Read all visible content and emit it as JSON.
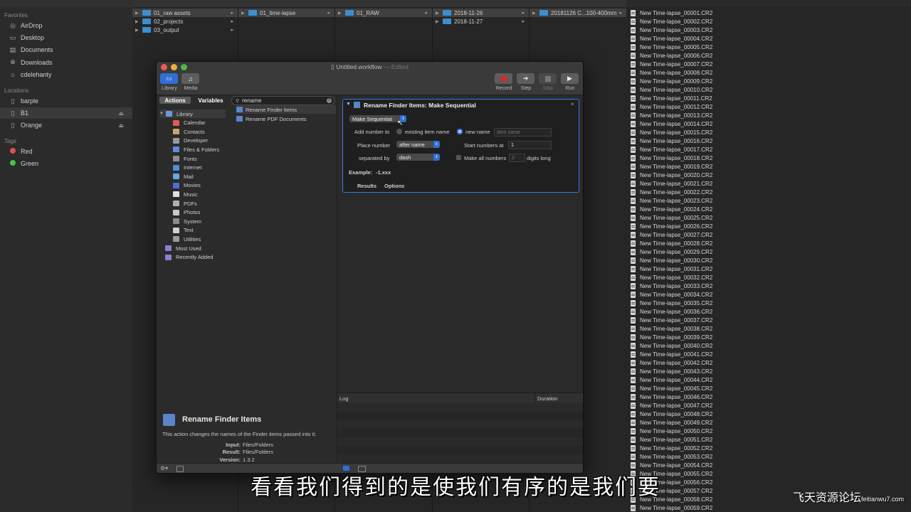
{
  "sidebar": {
    "favorites_label": "Favorites",
    "favorites": [
      {
        "label": "AirDrop",
        "icon": "airdrop-icon"
      },
      {
        "label": "Desktop",
        "icon": "desktop-icon"
      },
      {
        "label": "Documents",
        "icon": "documents-icon"
      },
      {
        "label": "Downloads",
        "icon": "downloads-icon"
      },
      {
        "label": "cdelehanty",
        "icon": "home-icon"
      }
    ],
    "locations_label": "Locations",
    "locations": [
      {
        "label": "barple",
        "icon": "disk-icon"
      },
      {
        "label": "B1",
        "icon": "disk-icon",
        "selected": true
      },
      {
        "label": "Orange",
        "icon": "disk-icon"
      }
    ],
    "tags_label": "Tags",
    "tags": [
      {
        "label": "Red",
        "color": "#e0504a"
      },
      {
        "label": "Green",
        "color": "#3ec64a"
      }
    ]
  },
  "columns": {
    "col1": [
      "01_raw assets",
      "02_projects",
      "03_output"
    ],
    "col2": [
      "01_time-lapse"
    ],
    "col3": [
      "01_RAW"
    ],
    "col4": [
      "2018-11-26",
      "2018-11-27"
    ],
    "col5": [
      "20181126 C...100-400mm"
    ]
  },
  "files": [
    "New Time-lapse_00001.CR2",
    "New Time-lapse_00002.CR2",
    "New Time-lapse_00003.CR2",
    "New Time-lapse_00004.CR2",
    "New Time-lapse_00005.CR2",
    "New Time-lapse_00006.CR2",
    "New Time-lapse_00007.CR2",
    "New Time-lapse_00008.CR2",
    "New Time-lapse_00009.CR2",
    "New Time-lapse_00010.CR2",
    "New Time-lapse_00011.CR2",
    "New Time-lapse_00012.CR2",
    "New Time-lapse_00013.CR2",
    "New Time-lapse_00014.CR2",
    "New Time-lapse_00015.CR2",
    "New Time-lapse_00016.CR2",
    "New Time-lapse_00017.CR2",
    "New Time-lapse_00018.CR2",
    "New Time-lapse_00019.CR2",
    "New Time-lapse_00020.CR2",
    "New Time-lapse_00021.CR2",
    "New Time-lapse_00022.CR2",
    "New Time-lapse_00023.CR2",
    "New Time-lapse_00024.CR2",
    "New Time-lapse_00025.CR2",
    "New Time-lapse_00026.CR2",
    "New Time-lapse_00027.CR2",
    "New Time-lapse_00028.CR2",
    "New Time-lapse_00029.CR2",
    "New Time-lapse_00030.CR2",
    "New Time-lapse_00031.CR2",
    "New Time-lapse_00032.CR2",
    "New Time-lapse_00033.CR2",
    "New Time-lapse_00034.CR2",
    "New Time-lapse_00035.CR2",
    "New Time-lapse_00036.CR2",
    "New Time-lapse_00037.CR2",
    "New Time-lapse_00038.CR2",
    "New Time-lapse_00039.CR2",
    "New Time-lapse_00040.CR2",
    "New Time-lapse_00041.CR2",
    "New Time-lapse_00042.CR2",
    "New Time-lapse_00043.CR2",
    "New Time-lapse_00044.CR2",
    "New Time-lapse_00045.CR2",
    "New Time-lapse_00046.CR2",
    "New Time-lapse_00047.CR2",
    "New Time-lapse_00048.CR2",
    "New Time-lapse_00049.CR2",
    "New Time-lapse_00050.CR2",
    "New Time-lapse_00051.CR2",
    "New Time-lapse_00052.CR2",
    "New Time-lapse_00053.CR2",
    "New Time-lapse_00054.CR2",
    "New Time-lapse_00055.CR2",
    "New Time-lapse_00056.CR2",
    "New Time-lapse_00057.CR2",
    "New Time-lapse_00058.CR2",
    "New Time-lapse_00059.CR2"
  ],
  "automator": {
    "title": "Untitled.workflow",
    "title_suffix": "— Edited",
    "toolbar": {
      "library": "Library",
      "media": "Media",
      "record": "Record",
      "step": "Step",
      "stop": "Stop",
      "run": "Run"
    },
    "tabs": {
      "actions": "Actions",
      "variables": "Variables"
    },
    "search_value": "rename",
    "library_items": [
      {
        "label": "Library",
        "color": "#6a9bd8"
      },
      {
        "label": "Calendar",
        "color": "#e35b4b"
      },
      {
        "label": "Contacts",
        "color": "#c9a46a"
      },
      {
        "label": "Developer",
        "color": "#9a9a9a"
      },
      {
        "label": "Files & Folders",
        "color": "#5d8ed6"
      },
      {
        "label": "Fonts",
        "color": "#8f8f8f"
      },
      {
        "label": "Internet",
        "color": "#4a8ed8"
      },
      {
        "label": "Mail",
        "color": "#6ba6e6"
      },
      {
        "label": "Movies",
        "color": "#4d6ed0"
      },
      {
        "label": "Music",
        "color": "#e0e0e0"
      },
      {
        "label": "PDFs",
        "color": "#b0b0b0"
      },
      {
        "label": "Photos",
        "color": "#c8c8c8"
      },
      {
        "label": "System",
        "color": "#8a8a8a"
      },
      {
        "label": "Text",
        "color": "#d0d0d0"
      },
      {
        "label": "Utilities",
        "color": "#9a9a9a"
      },
      {
        "label": "Most Used",
        "color": "#8a7fd0"
      },
      {
        "label": "Recently Added",
        "color": "#8a7fd0"
      }
    ],
    "actions": [
      "Rename Finder Items",
      "Rename PDF Documents"
    ],
    "description": {
      "title": "Rename Finder Items",
      "text": "This action changes the names of the Finder items passed into it.",
      "input_label": "Input:",
      "input_value": "Files/Folders",
      "result_label": "Result:",
      "result_value": "Files/Folders",
      "version_label": "Version:",
      "version_value": "1.3.2"
    },
    "action_card": {
      "title": "Rename Finder Items: Make Sequential",
      "mode": "Make Sequential",
      "add_number_label": "Add number to",
      "existing_label": "existing item name",
      "new_name_label": "new name",
      "name_placeholder": "Item name",
      "place_label": "Place number",
      "place_value": "after name",
      "start_label": "Start numbers at",
      "start_value": "1",
      "separated_label": "separated by",
      "separated_value": "dash",
      "make_all_label": "Make all numbers",
      "digits_value": "2",
      "digits_label": "digits long",
      "example_label": "Example:",
      "example_value": "-1.xxx",
      "results_tab": "Results",
      "options_tab": "Options"
    },
    "log": {
      "log_label": "Log",
      "duration_label": "Duration"
    }
  },
  "subtitle": "看看我们得到的是使我们有序的是我们要",
  "watermark": {
    "main": "飞天资源论坛",
    "sub": "feitianwu7.com"
  }
}
